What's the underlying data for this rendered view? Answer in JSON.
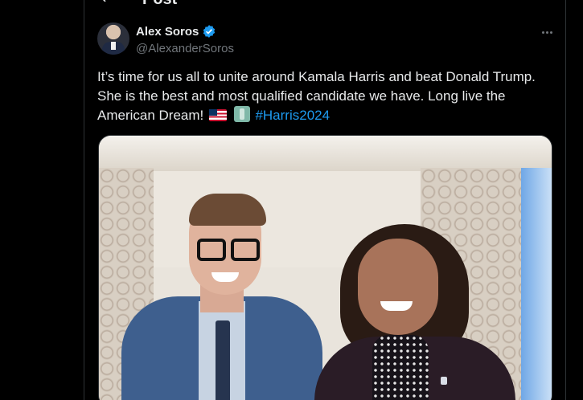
{
  "header": {
    "title": "Post"
  },
  "post": {
    "author": {
      "display_name": "Alex Soros",
      "handle": "@AlexanderSoros",
      "verified": true
    },
    "text_main": "It’s time for us all to unite around Kamala Harris and beat Donald Trump. She is the best and most qualified candidate we have. Long live the American Dream! ",
    "emoji": [
      "flag-us-icon",
      "statue-of-liberty-icon"
    ],
    "hashtag": "#Harris2024"
  },
  "colors": {
    "background": "#000000",
    "text": "#e7e9ea",
    "muted": "#71767b",
    "link": "#1d9bf0",
    "verified": "#1d9bf0"
  }
}
